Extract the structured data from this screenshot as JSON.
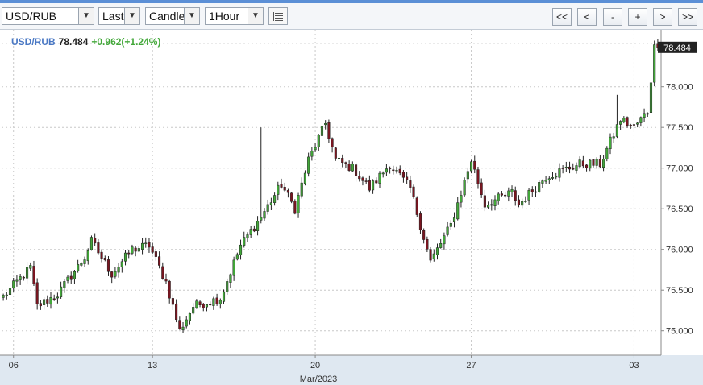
{
  "toolbar": {
    "symbol": "USD/RUB",
    "price_type": "Last",
    "chart_type": "Candle",
    "interval": "1Hour",
    "list_icon": "list-icon",
    "nav": {
      "first": "<<",
      "prev": "<",
      "zoom_out": "-",
      "zoom_in": "+",
      "next": ">",
      "last": ">>"
    }
  },
  "legend": {
    "symbol": "USD/RUB",
    "value": "78.484",
    "change": "+0.962(+1.24%)"
  },
  "colors": {
    "up": "#43a83a",
    "down": "#7a1520",
    "legend_symbol": "#4a78c4",
    "change": "#43a83a",
    "last_price_tag": "#222222"
  },
  "chart_data": {
    "type": "candlestick",
    "symbol": "USD/RUB",
    "interval": "1Hour",
    "x_period": "Mar/2023",
    "ylim": [
      74.7,
      78.7
    ],
    "y_ticks": [
      75.0,
      75.5,
      76.0,
      76.5,
      77.0,
      77.5,
      78.0
    ],
    "y_tick_labels": [
      "75.000",
      "75.500",
      "76.000",
      "76.500",
      "77.000",
      "77.500",
      "78.000"
    ],
    "x_ticks": [
      {
        "label": "06",
        "index": 3
      },
      {
        "label": "13",
        "index": 44
      },
      {
        "label": "20",
        "index": 92
      },
      {
        "label": "27",
        "index": 138
      },
      {
        "label": "03",
        "index": 186
      }
    ],
    "last_price": 78.484,
    "last_price_label": "78.484",
    "grid": true,
    "key_points": [
      [
        0,
        75.42
      ],
      [
        8,
        75.78
      ],
      [
        10,
        75.3
      ],
      [
        16,
        75.45
      ],
      [
        24,
        75.9
      ],
      [
        26,
        76.1
      ],
      [
        32,
        75.7
      ],
      [
        38,
        76.0
      ],
      [
        43,
        76.05
      ],
      [
        48,
        75.6
      ],
      [
        52,
        75.0
      ],
      [
        56,
        75.3
      ],
      [
        64,
        75.4
      ],
      [
        70,
        76.05
      ],
      [
        76,
        76.4
      ],
      [
        82,
        76.8
      ],
      [
        86,
        76.5
      ],
      [
        90,
        77.1
      ],
      [
        95,
        77.55
      ],
      [
        98,
        77.1
      ],
      [
        103,
        77.0
      ],
      [
        108,
        76.75
      ],
      [
        114,
        77.05
      ],
      [
        120,
        76.75
      ],
      [
        126,
        75.85
      ],
      [
        132,
        76.3
      ],
      [
        138,
        77.1
      ],
      [
        142,
        76.55
      ],
      [
        150,
        76.7
      ],
      [
        152,
        76.55
      ],
      [
        160,
        76.9
      ],
      [
        170,
        77.05
      ],
      [
        176,
        77.05
      ],
      [
        182,
        77.6
      ],
      [
        186,
        77.5
      ],
      [
        190,
        77.7
      ],
      [
        192,
        78.484
      ]
    ],
    "notable_wicks": [
      {
        "index": 76,
        "high": 77.5
      },
      {
        "index": 94,
        "high": 77.75
      },
      {
        "index": 181,
        "high": 77.9
      }
    ]
  }
}
